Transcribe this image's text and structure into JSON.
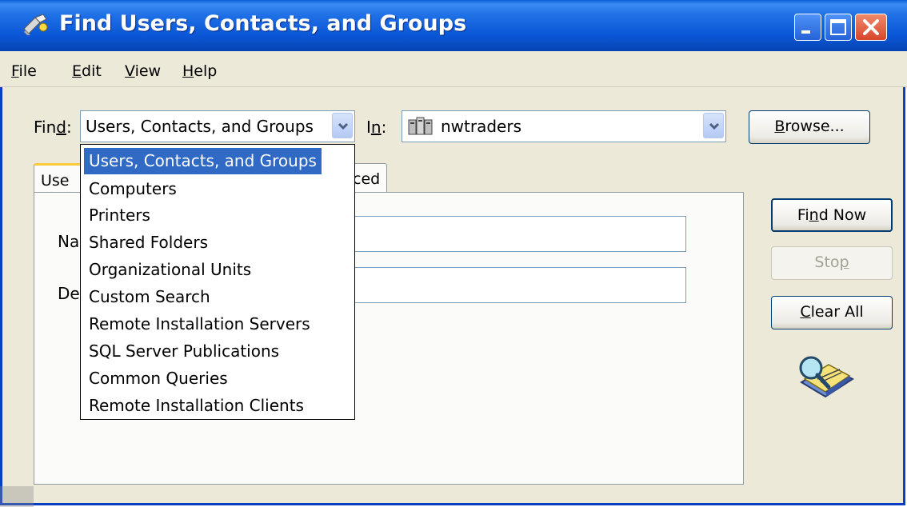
{
  "window": {
    "title": "Find Users, Contacts, and Groups",
    "colors": {
      "titlebar": "#0a56d6",
      "selection": "#316ac5",
      "face": "#ece9d8",
      "active_tab_accent": "#ffc83d"
    }
  },
  "menu": {
    "items": [
      {
        "underline": "F",
        "rest": "ile"
      },
      {
        "underline": "E",
        "rest": "dit"
      },
      {
        "underline": "V",
        "rest": "iew"
      },
      {
        "underline": "H",
        "rest": "elp"
      }
    ]
  },
  "find": {
    "label_pre": "Fin",
    "label_underline": "d",
    "label_post": ":",
    "selected": "Users, Contacts, and Groups",
    "options": [
      "Users, Contacts, and Groups",
      "Computers",
      "Printers",
      "Shared Folders",
      "Organizational Units",
      "Custom Search",
      "Remote Installation Servers",
      "SQL Server Publications",
      "Common Queries",
      "Remote Installation Clients"
    ]
  },
  "in": {
    "label_pre": "I",
    "label_underline": "n",
    "label_post": ":",
    "value": "nwtraders",
    "icon": "domain-server-icon"
  },
  "buttons": {
    "browse": {
      "underline": "B",
      "rest": "rowse..."
    },
    "find_now": {
      "pre": "Fi",
      "underline": "n",
      "post": "d Now"
    },
    "stop": {
      "pre": "Sto",
      "underline": "p",
      "post": ""
    },
    "clear_all": {
      "underline": "C",
      "rest": "lear All"
    }
  },
  "tabs": {
    "first_visible": "Use",
    "second_visible": "ced"
  },
  "form": {
    "name_label_visible": "Na",
    "description_label_visible": "De"
  },
  "icons": {
    "title": "find-flashlight-icon",
    "search_graphic": "search-magnifier-book-icon"
  }
}
